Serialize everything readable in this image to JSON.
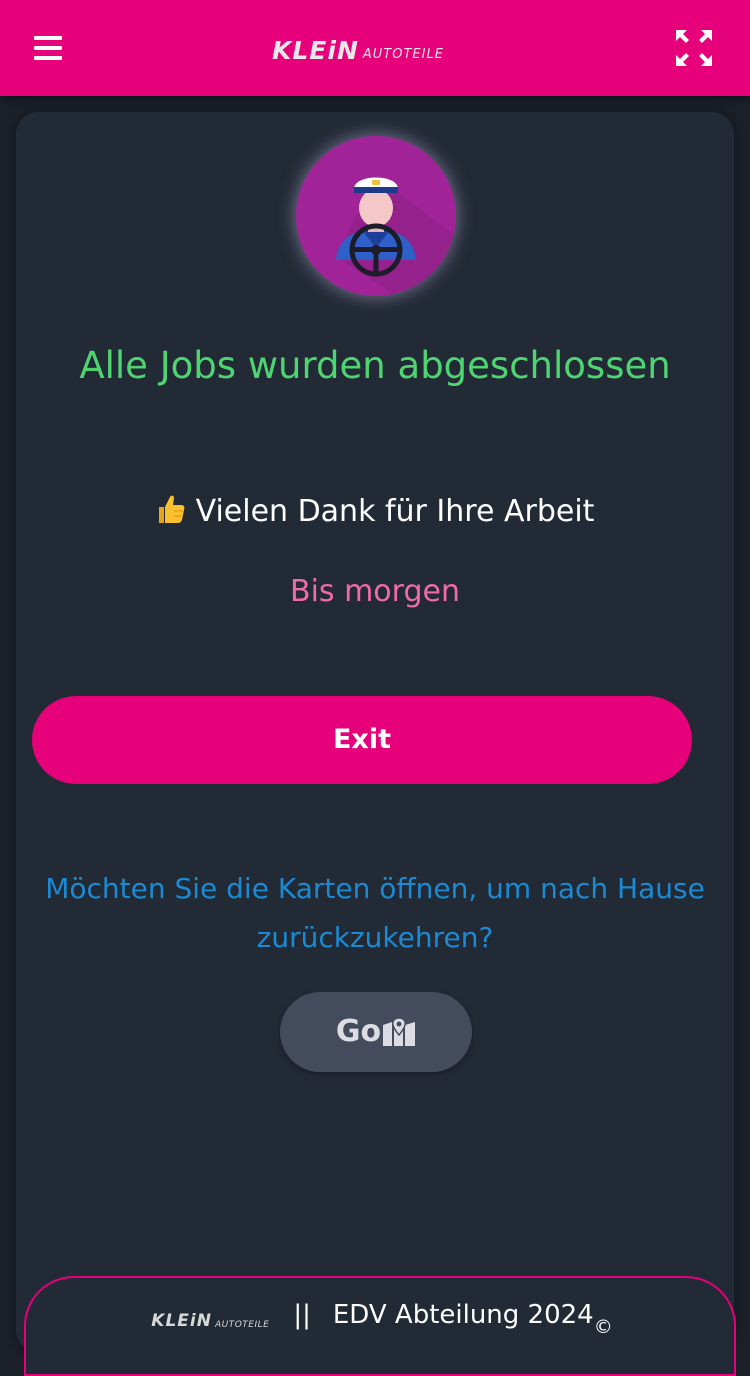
{
  "header": {
    "menu_icon": "hamburger-menu-icon",
    "logo_brand": "KLEiN",
    "logo_sub": "AUTOTEILE",
    "fullscreen_icon": "fullscreen-expand-icon",
    "bar_color": "#e6007a"
  },
  "avatar": {
    "icon": "driver-with-steering-wheel-icon",
    "bg_color": "#a02497"
  },
  "main": {
    "title": "Alle Jobs wurden abgeschlossen",
    "thanks_emoji": "👍",
    "thanks": "Vielen Dank für Ihre Arbeit",
    "bye": "Bis morgen",
    "exit_label": "Exit",
    "question": "Möchten Sie die Karten öffnen, um nach Hause zurückzukehren?",
    "go_label": "Go",
    "go_icon": "map-icon"
  },
  "footer": {
    "logo_brand": "KLEiN",
    "logo_sub": "AUTOTEILE",
    "separator": "||",
    "department": "EDV Abteilung 2024",
    "copyright": "©"
  },
  "colors": {
    "accent": "#e6007a",
    "title_green": "#4fd472",
    "bye_pink": "#ef6ba8",
    "question_blue": "#1a8ad2",
    "card_bg": "#222a36",
    "page_bg": "#1b2029"
  }
}
